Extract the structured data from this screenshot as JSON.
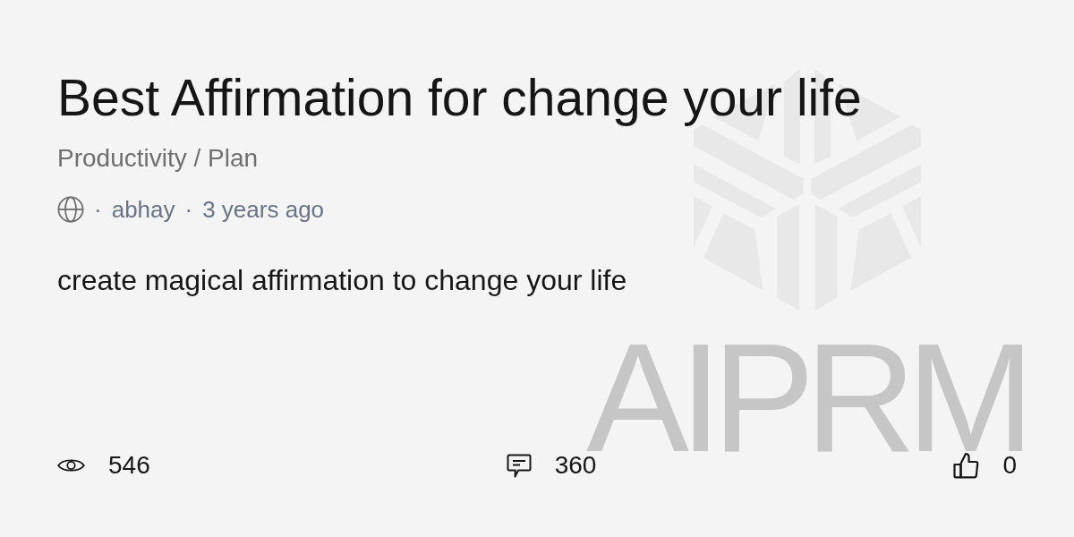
{
  "title": "Best Affirmation for change your life",
  "category": "Productivity / Plan",
  "meta": [
    {
      "kind": "separator",
      "text": "·"
    },
    {
      "kind": "author",
      "text": "abhay"
    },
    {
      "kind": "separator",
      "text": "·"
    },
    {
      "kind": "time",
      "text": "3 years ago"
    }
  ],
  "description": "create magical affirmation to change your life",
  "stats": [
    {
      "kind": "views",
      "count": "546"
    },
    {
      "kind": "comments",
      "count": "360"
    },
    {
      "kind": "likes",
      "count": "0"
    }
  ],
  "background_logo": {
    "text": "AIPRM"
  }
}
